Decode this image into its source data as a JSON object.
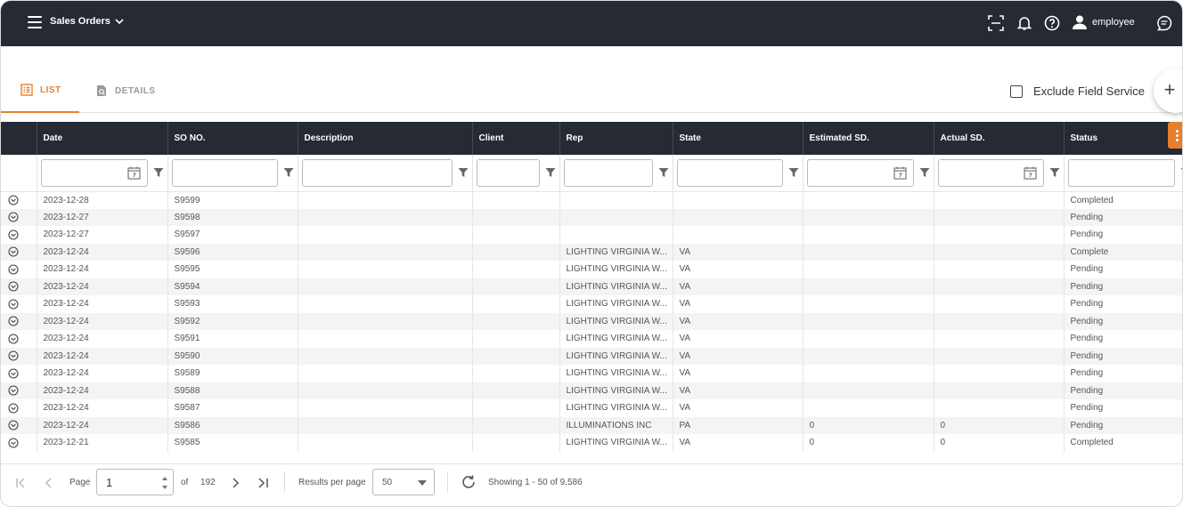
{
  "app": {
    "title": "Sales Orders",
    "user": "employee"
  },
  "tabs": [
    {
      "label": "LIST"
    },
    {
      "label": "DETAILS"
    }
  ],
  "exclude_field_service": {
    "label": "Exclude Field Service",
    "checked": false
  },
  "add_button": {
    "label": "+"
  },
  "columns": [
    "Date",
    "SO NO.",
    "Description",
    "Client",
    "Rep",
    "State",
    "Estimated SD.",
    "Actual SD.",
    "Status"
  ],
  "rows": [
    [
      "2023-12-28",
      "S9599",
      "",
      "",
      "",
      "",
      "",
      "",
      "Completed"
    ],
    [
      "2023-12-27",
      "S9598",
      "",
      "",
      "",
      "",
      "",
      "",
      "Pending"
    ],
    [
      "2023-12-27",
      "S9597",
      "",
      "",
      "",
      "",
      "",
      "",
      "Pending"
    ],
    [
      "2023-12-24",
      "S9596",
      "",
      "",
      "LIGHTING VIRGINIA W...",
      "VA",
      "",
      "",
      "Complete"
    ],
    [
      "2023-12-24",
      "S9595",
      "",
      "",
      "LIGHTING VIRGINIA W...",
      "VA",
      "",
      "",
      "Pending"
    ],
    [
      "2023-12-24",
      "S9594",
      "",
      "",
      "LIGHTING VIRGINIA W...",
      "VA",
      "",
      "",
      "Pending"
    ],
    [
      "2023-12-24",
      "S9593",
      "",
      "",
      "LIGHTING VIRGINIA W...",
      "VA",
      "",
      "",
      "Pending"
    ],
    [
      "2023-12-24",
      "S9592",
      "",
      "",
      "LIGHTING VIRGINIA W...",
      "VA",
      "",
      "",
      "Pending"
    ],
    [
      "2023-12-24",
      "S9591",
      "",
      "",
      "LIGHTING VIRGINIA W...",
      "VA",
      "",
      "",
      "Pending"
    ],
    [
      "2023-12-24",
      "S9590",
      "",
      "",
      "LIGHTING VIRGINIA W...",
      "VA",
      "",
      "",
      "Pending"
    ],
    [
      "2023-12-24",
      "S9589",
      "",
      "",
      "LIGHTING VIRGINIA W...",
      "VA",
      "",
      "",
      "Pending"
    ],
    [
      "2023-12-24",
      "S9588",
      "",
      "",
      "LIGHTING VIRGINIA W...",
      "VA",
      "",
      "",
      "Pending"
    ],
    [
      "2023-12-24",
      "S9587",
      "",
      "",
      "LIGHTING VIRGINIA W...",
      "VA",
      "",
      "",
      "Pending"
    ],
    [
      "2023-12-24",
      "S9586",
      "",
      "",
      "ILLUMINATIONS INC",
      "PA",
      "0",
      "0",
      "Pending"
    ],
    [
      "2023-12-21",
      "S9585",
      "",
      "",
      "LIGHTING VIRGINIA W...",
      "VA",
      "0",
      "0",
      "Completed"
    ]
  ],
  "pager": {
    "page_label": "Page",
    "page_value": "1",
    "of_label": "of",
    "total_pages": "192",
    "per_page_label": "Results per page",
    "per_page_value": "50",
    "showing": "Showing 1 - 50 of 9,586"
  },
  "colors": {
    "topbar": "#252a33",
    "accent": "#e87f2c"
  }
}
